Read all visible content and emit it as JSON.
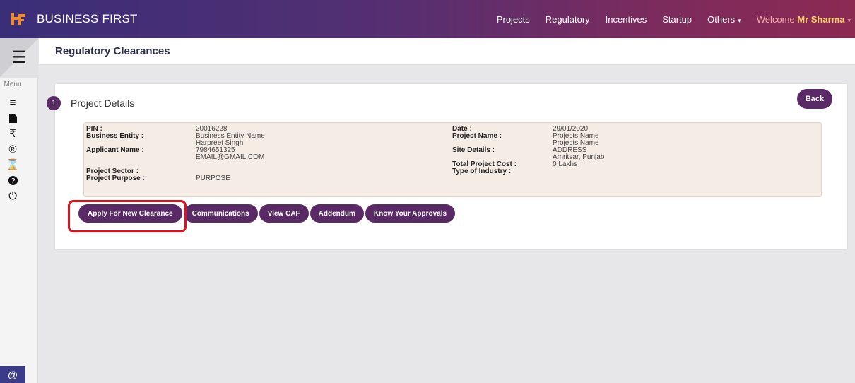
{
  "header": {
    "brand": "BUSINESS FIRST",
    "nav": [
      {
        "label": "Projects"
      },
      {
        "label": "Regulatory"
      },
      {
        "label": "Incentives"
      },
      {
        "label": "Startup"
      },
      {
        "label": "Others"
      }
    ],
    "welcome_prefix": "Welcome",
    "welcome_name": "Mr Sharma"
  },
  "sidebar": {
    "menu_label": "Menu",
    "icons": [
      "list-icon",
      "file-icon",
      "rupee-icon",
      "registered-icon",
      "hourglass-icon",
      "help-icon",
      "power-icon"
    ],
    "bottom_icon": "@"
  },
  "page": {
    "title": "Regulatory Clearances"
  },
  "card": {
    "step_number": "1",
    "title": "Project Details",
    "back_label": "Back"
  },
  "details": {
    "left": [
      {
        "label": "PIN :",
        "value": "20016228"
      },
      {
        "label": "Business Entity :",
        "value": "Business Entity Name"
      },
      {
        "label": "",
        "value": "Harpreet Singh"
      },
      {
        "label": "Applicant Name :",
        "value": "7984651325"
      },
      {
        "label": "",
        "value": "EMAIL@GMAIL.COM"
      },
      {
        "label": "",
        "value": ""
      },
      {
        "label": "Project Sector :",
        "value": ""
      },
      {
        "label": "Project Purpose :",
        "value": "PURPOSE"
      }
    ],
    "right": [
      {
        "label": "Date :",
        "value": "29/01/2020"
      },
      {
        "label": "Project Name :",
        "value": "Projects Name"
      },
      {
        "label": "",
        "value": "Projects Name"
      },
      {
        "label": "Site Details :",
        "value": "ADDRESS"
      },
      {
        "label": "",
        "value": "Amritsar, Punjab"
      },
      {
        "label": "Total Project Cost :",
        "value": "0 Lakhs"
      },
      {
        "label": "Type of Industry :",
        "value": ""
      }
    ]
  },
  "actions": [
    {
      "label": "Apply For New Clearance"
    },
    {
      "label": "Communications"
    },
    {
      "label": "View CAF"
    },
    {
      "label": "Addendum"
    },
    {
      "label": "Know Your Approvals"
    }
  ],
  "colors": {
    "accent": "#5a2a66",
    "highlight": "#e0101a"
  }
}
